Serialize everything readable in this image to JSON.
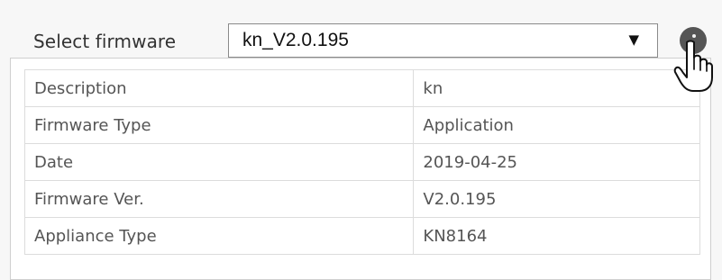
{
  "firmware_selector": {
    "label": "Select firmware",
    "value": "kn_V2.0.195",
    "arrow": "▼"
  },
  "details": [
    {
      "key": "Description",
      "value": "kn"
    },
    {
      "key": "Firmware Type",
      "value": "Application"
    },
    {
      "key": "Date",
      "value": "2019-04-25"
    },
    {
      "key": "Firmware Ver.",
      "value": "V2.0.195"
    },
    {
      "key": "Appliance Type",
      "value": "KN8164"
    }
  ],
  "icons": {
    "info": "info-icon",
    "cursor": "hand-pointer-icon"
  }
}
